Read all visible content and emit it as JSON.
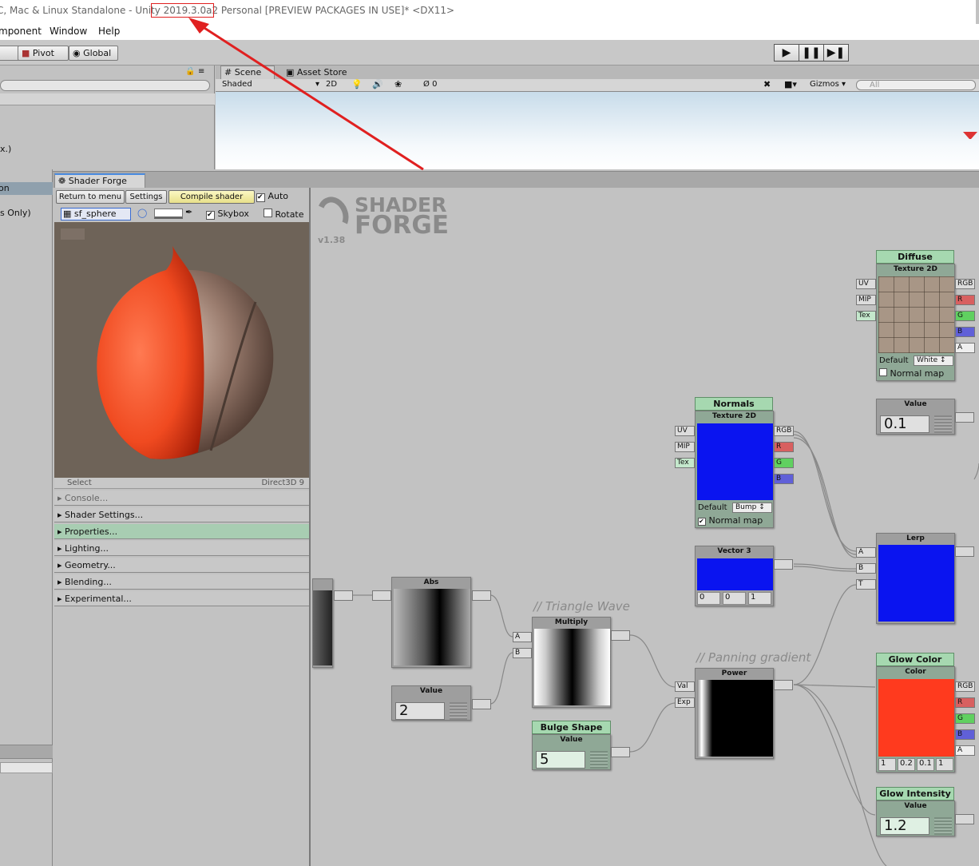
{
  "window_title": "C, Mac & Linux Standalone - Unity 2019.3.0a2 Personal [PREVIEW PACKAGES IN USE]* <DX11>",
  "menu": [
    "mponent",
    "Window",
    "Help"
  ],
  "toolbar": {
    "pivot": "Pivot",
    "global": "Global"
  },
  "left_panel": {
    "item1": "x.)",
    "item2": "on",
    "item3": "s Only)"
  },
  "scene": {
    "tabs": [
      "Scene",
      "Asset Store"
    ],
    "shading": "Shaded",
    "mode_2d": "2D",
    "layers": "0",
    "gizmos": "Gizmos",
    "search_placeholder": "All"
  },
  "shader_forge": {
    "tab": "Shader Forge",
    "return_btn": "Return to menu",
    "settings_btn": "Settings",
    "compile_btn": "Compile shader",
    "auto_label": "Auto",
    "mesh": "sf_sphere",
    "skybox_label": "Skybox",
    "rotate_label": "Rotate",
    "select_label": "Select",
    "renderer": "Direct3D 9",
    "sections": [
      "Console...",
      "Shader Settings...",
      "Properties...",
      "Lighting...",
      "Geometry...",
      "Blending...",
      "Experimental..."
    ],
    "logo_line1": "SHADER",
    "logo_line2": "FORGE",
    "version": "v1.38"
  },
  "nodes": {
    "diffuse": {
      "name": "Diffuse",
      "type": "Texture 2D",
      "inputs": [
        "UV",
        "MIP",
        "Tex"
      ],
      "outputs": [
        "RGB",
        "R",
        "G",
        "B",
        "A"
      ],
      "default_label": "Default",
      "default_value": "White",
      "normal_map": "Normal map"
    },
    "value01": {
      "type": "Value",
      "value": "0.1"
    },
    "normals": {
      "name": "Normals",
      "type": "Texture 2D",
      "inputs": [
        "UV",
        "MIP",
        "Tex"
      ],
      "outputs": [
        "RGB",
        "R",
        "G",
        "B"
      ],
      "default_label": "Default",
      "default_value": "Bump",
      "normal_map": "Normal map"
    },
    "vector3": {
      "type": "Vector 3",
      "values": [
        "0",
        "0",
        "1"
      ]
    },
    "lerp": {
      "type": "Lerp",
      "inputs": [
        "A",
        "B",
        "T"
      ]
    },
    "abs": {
      "type": "Abs"
    },
    "value2": {
      "type": "Value",
      "value": "2"
    },
    "multiply": {
      "type": "Multiply",
      "inputs": [
        "A",
        "B"
      ],
      "comment": "// Triangle Wave"
    },
    "bulge": {
      "name": "Bulge Shape",
      "type": "Value",
      "value": "5"
    },
    "power": {
      "type": "Power",
      "inputs": [
        "Val",
        "Exp"
      ],
      "comment": "// Panning gradient"
    },
    "glow_color": {
      "name": "Glow Color",
      "type": "Color",
      "outputs": [
        "RGB",
        "R",
        "G",
        "B",
        "A"
      ],
      "values": [
        "1",
        "0.2",
        "0.1",
        "1"
      ]
    },
    "glow_intensity": {
      "name": "Glow Intensity",
      "type": "Value",
      "value": "1.2"
    }
  },
  "colors": {
    "glow": "#ff3a1e",
    "normal_blue": "#0a14f0",
    "param_green": "#a6d8b0"
  }
}
